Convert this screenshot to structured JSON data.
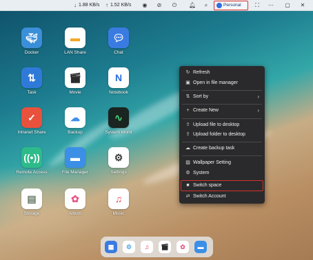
{
  "topbar": {
    "download_speed": "1.88 KB/s",
    "upload_speed": "1.52 KB/s",
    "user_label": "Personal",
    "icons": [
      "arrow-down-icon",
      "arrow-up-icon",
      "circle-app-icon",
      "no-sign-icon",
      "power-icon",
      "bell-icon",
      "search-icon",
      "user-icon",
      "fullscreen-icon",
      "more-icon",
      "window-icon",
      "close-icon"
    ]
  },
  "desktop": {
    "apps": [
      {
        "label": "Docker",
        "icon": "docker-icon",
        "color": "#3a8fd8"
      },
      {
        "label": "LAN Share",
        "icon": "folder-icon",
        "color": "#f2a82a"
      },
      {
        "label": "Chat",
        "icon": "chat-icon",
        "color": "#3a7be2"
      },
      {
        "label": "Task",
        "icon": "task-icon",
        "color": "#2f7ad8"
      },
      {
        "label": "Movie",
        "icon": "movie-icon",
        "color": "#2a2a2a"
      },
      {
        "label": "Notebook",
        "icon": "notebook-icon",
        "color": "#2b6ee0"
      },
      {
        "label": "Intranet Share",
        "icon": "share-icon",
        "color": "#e8513c"
      },
      {
        "label": "Backup",
        "icon": "cloud-icon",
        "color": "#3e90e8"
      },
      {
        "label": "System Monit",
        "icon": "monitor-icon",
        "color": "#1a2420"
      },
      {
        "label": "Remote Access",
        "icon": "remote-icon",
        "color": "#2dbb8a"
      },
      {
        "label": "File Manager",
        "icon": "folder-icon",
        "color": "#3b8fe6"
      },
      {
        "label": "Settings",
        "icon": "gear-icon",
        "color": "#3a3a3a"
      },
      {
        "label": "Storage",
        "icon": "storage-icon",
        "color": "#8a9a8a"
      },
      {
        "label": "Album",
        "icon": "album-icon",
        "color": "#e85a8a"
      },
      {
        "label": "Music",
        "icon": "music-icon",
        "color": "#f0405a"
      }
    ]
  },
  "context_menu": {
    "items": [
      {
        "label": "Refresh",
        "icon": "refresh-icon"
      },
      {
        "label": "Open in file manager",
        "icon": "file-manager-icon"
      },
      {
        "label": "Sort by",
        "icon": "sort-icon"
      },
      {
        "label": "Create New",
        "icon": "plus-icon"
      },
      {
        "label": "Upload file to desktop",
        "icon": "upload-icon"
      },
      {
        "label": "Upload folder to desktop",
        "icon": "upload-folder-icon"
      },
      {
        "label": "Create backup task",
        "icon": "cloud-icon"
      },
      {
        "label": "Wallpaper Setting",
        "icon": "image-icon"
      },
      {
        "label": "System",
        "icon": "gear-icon"
      },
      {
        "label": "Switch space",
        "icon": "switch-icon"
      },
      {
        "label": "Switch Account",
        "icon": "swap-icon"
      }
    ]
  },
  "dock": {
    "apps": [
      {
        "icon": "app-grid-icon",
        "color": "#3a7be2"
      },
      {
        "icon": "settings-app-icon",
        "color": "#5aa8e8"
      },
      {
        "icon": "music-icon",
        "color": "#f0405a"
      },
      {
        "icon": "movie-icon",
        "color": "#2a2a2a"
      },
      {
        "icon": "album-icon",
        "color": "#e85a8a"
      },
      {
        "icon": "folder-icon",
        "color": "#3b8fe6"
      }
    ]
  },
  "highlight_color": "#d9312b"
}
